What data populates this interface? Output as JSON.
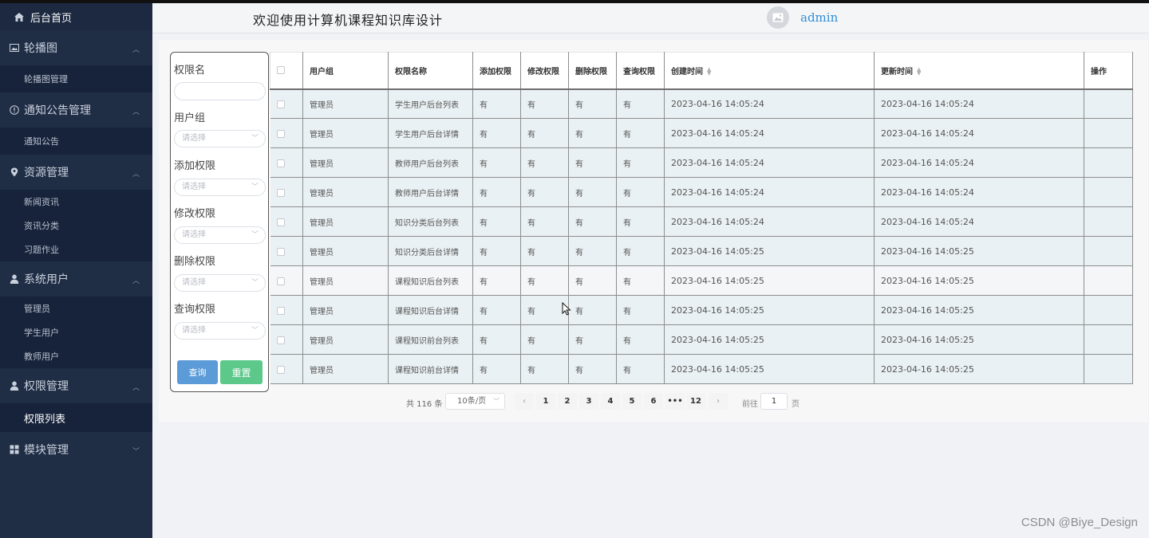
{
  "sidebar": {
    "home": "后台首页",
    "groups": [
      {
        "label": "轮播图",
        "icon": "image-icon",
        "items": [
          "轮播图管理"
        ]
      },
      {
        "label": "通知公告管理",
        "icon": "info-icon",
        "items": [
          "通知公告"
        ]
      },
      {
        "label": "资源管理",
        "icon": "location-icon",
        "items": [
          "新闻资讯",
          "资讯分类",
          "习题作业"
        ]
      },
      {
        "label": "系统用户",
        "icon": "user-icon",
        "items": [
          "管理员",
          "学生用户",
          "教师用户"
        ]
      },
      {
        "label": "权限管理",
        "icon": "user-icon",
        "items": [
          "权限列表"
        ]
      },
      {
        "label": "模块管理",
        "icon": "grid-icon",
        "items": []
      }
    ]
  },
  "header": {
    "title": "欢迎使用计算机课程知识库设计",
    "username": "admin"
  },
  "filter": {
    "perm_name_label": "权限名",
    "user_group_label": "用户组",
    "add_perm_label": "添加权限",
    "edit_perm_label": "修改权限",
    "delete_perm_label": "删除权限",
    "query_perm_label": "查询权限",
    "select_placeholder": "请选择",
    "search_button": "查询",
    "reset_button": "重置"
  },
  "table": {
    "columns": [
      "用户组",
      "权限名称",
      "添加权限",
      "修改权限",
      "删除权限",
      "查询权限",
      "创建时间",
      "更新时间",
      "操作"
    ],
    "rows": [
      [
        "管理员",
        "学生用户后台列表",
        "有",
        "有",
        "有",
        "有",
        "2023-04-16 14:05:24",
        "2023-04-16 14:05:24"
      ],
      [
        "管理员",
        "学生用户后台详情",
        "有",
        "有",
        "有",
        "有",
        "2023-04-16 14:05:24",
        "2023-04-16 14:05:24"
      ],
      [
        "管理员",
        "教师用户后台列表",
        "有",
        "有",
        "有",
        "有",
        "2023-04-16 14:05:24",
        "2023-04-16 14:05:24"
      ],
      [
        "管理员",
        "教师用户后台详情",
        "有",
        "有",
        "有",
        "有",
        "2023-04-16 14:05:24",
        "2023-04-16 14:05:24"
      ],
      [
        "管理员",
        "知识分类后台列表",
        "有",
        "有",
        "有",
        "有",
        "2023-04-16 14:05:24",
        "2023-04-16 14:05:24"
      ],
      [
        "管理员",
        "知识分类后台详情",
        "有",
        "有",
        "有",
        "有",
        "2023-04-16 14:05:25",
        "2023-04-16 14:05:25"
      ],
      [
        "管理员",
        "课程知识后台列表",
        "有",
        "有",
        "有",
        "有",
        "2023-04-16 14:05:25",
        "2023-04-16 14:05:25"
      ],
      [
        "管理员",
        "课程知识后台详情",
        "有",
        "有",
        "有",
        "有",
        "2023-04-16 14:05:25",
        "2023-04-16 14:05:25"
      ],
      [
        "管理员",
        "课程知识前台列表",
        "有",
        "有",
        "有",
        "有",
        "2023-04-16 14:05:25",
        "2023-04-16 14:05:25"
      ],
      [
        "管理员",
        "课程知识前台详情",
        "有",
        "有",
        "有",
        "有",
        "2023-04-16 14:05:25",
        "2023-04-16 14:05:25"
      ]
    ]
  },
  "pagination": {
    "total": "共 116 条",
    "page_size": "10条/页",
    "pages": [
      "1",
      "2",
      "3",
      "4",
      "5",
      "6",
      "•••",
      "12"
    ],
    "goto_label": "前往",
    "goto_value": "1",
    "goto_unit": "页"
  },
  "watermark": "CSDN @Biye_Design"
}
